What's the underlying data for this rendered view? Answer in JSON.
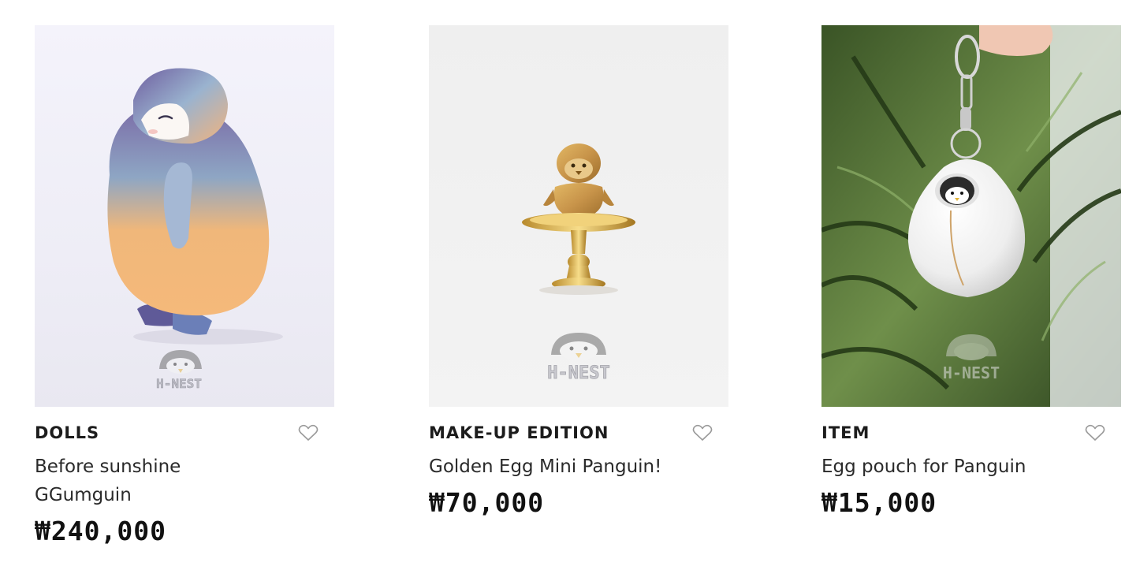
{
  "products": [
    {
      "category": "DOLLS",
      "name_line1": "Before sunshine",
      "name_line2": "GGumguin",
      "price": "₩240,000",
      "watermark": "H-NEST",
      "favorite_icon": "heart-outline-icon"
    },
    {
      "category": "MAKE-UP EDITION",
      "name_line1": "Golden Egg Mini Panguin!",
      "price": "₩70,000",
      "watermark": "H-NEST",
      "favorite_icon": "heart-outline-icon"
    },
    {
      "category": "ITEM",
      "name_line1": "Egg pouch for Panguin",
      "price": "₩15,000",
      "watermark": "H-NEST",
      "favorite_icon": "heart-outline-icon"
    }
  ],
  "colors": {
    "text": "#1c1c1c",
    "heart_outline": "#9a9a9a",
    "background": "#ffffff"
  }
}
